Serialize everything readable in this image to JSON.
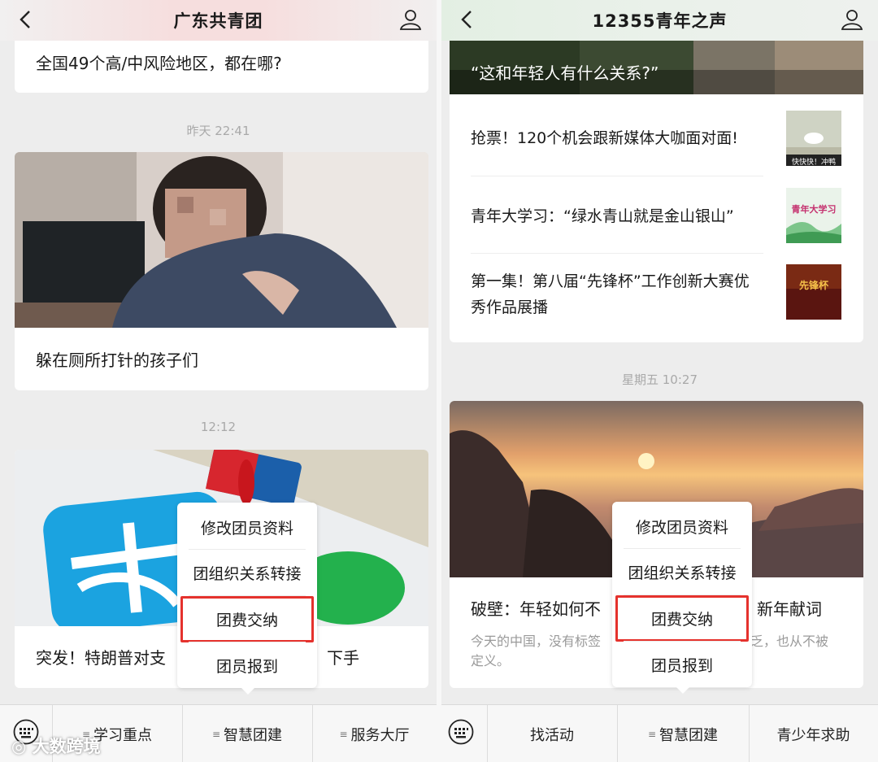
{
  "left": {
    "title": "广东共青团",
    "card1_text": "全国49个高/中风险地区，都在哪?",
    "time1": "昨天 22:41",
    "card2_text": "躲在厕所打针的孩子们",
    "time2": "12:12",
    "card3_text": "突发！特朗普对支",
    "card3_text_end": "下手",
    "popup": [
      "修改团员资料",
      "团组织关系转接",
      "团费交纳",
      "团员报到"
    ],
    "tabs": [
      "学习重点",
      "智慧团建",
      "服务大厅"
    ]
  },
  "right": {
    "title": "12355青年之声",
    "hero_caption": "“这和年轻人有什么关系?”",
    "articles": [
      {
        "text": "抢票！120个机会跟新媒体大咖面对面!",
        "thumb_label": "快快快！冲鸭"
      },
      {
        "text": "青年大学习：“绿水青山就是金山银山”",
        "thumb_label": "青年大学习"
      },
      {
        "text": "第一集！第八届“先锋杯”工作创新大赛优秀作品展播",
        "thumb_label": "先锋杯"
      }
    ],
    "time": "星期五 10:27",
    "card_title_a": "破壁：年轻如何不",
    "card_title_b": "新年献词",
    "card_desc_a": "今天的中国，没有标签",
    "card_desc_b": "乏，也从不被",
    "card_desc_c": "定义。",
    "popup": [
      "修改团员资料",
      "团组织关系转接",
      "团费交纳",
      "团员报到"
    ],
    "tabs": [
      "找活动",
      "智慧团建",
      "青少年求助"
    ]
  },
  "watermark": "大数跨境",
  "colors": {
    "highlight": "#e5322d",
    "panel_bg": "#ededed",
    "time_text": "#a9a9a9"
  },
  "icons": [
    "back-arrow-icon",
    "user-icon",
    "keyboard-icon",
    "menu-lines-icon"
  ]
}
